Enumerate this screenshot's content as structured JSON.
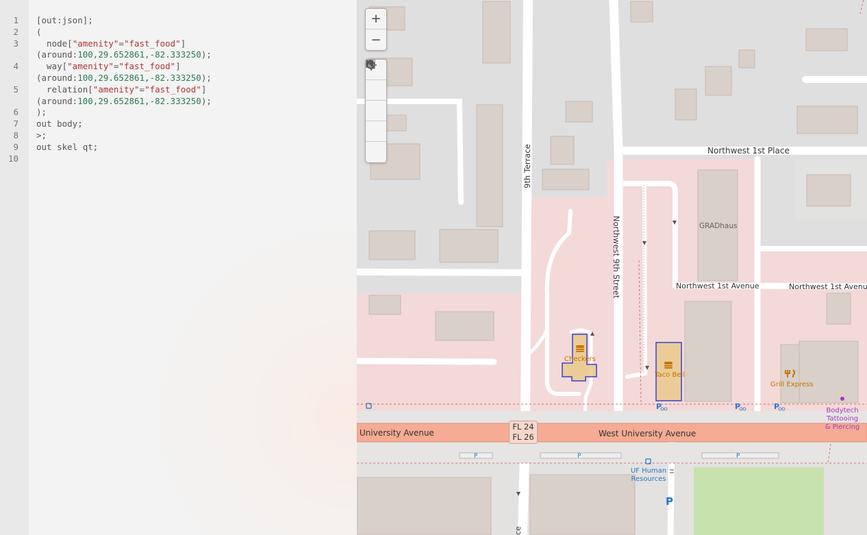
{
  "editor": {
    "line_numbers": [
      "1",
      "2",
      "3",
      "4",
      "5",
      "6",
      "7",
      "8",
      "9",
      "10"
    ],
    "lines": {
      "l1": "[out:json];",
      "l2": "(",
      "l3a_kw": "  node[",
      "l3a_s1": "\"amenity\"",
      "l3a_eq": "=",
      "l3a_s2": "\"fast_food\"",
      "l3a_end": "]",
      "l3b_pre": "(around:",
      "l3b_nums": "100,29.652861,-82.333250",
      "l3b_end": ");",
      "l4a_kw": "  way[",
      "l4a_s1": "\"amenity\"",
      "l4a_eq": "=",
      "l4a_s2": "\"fast_food\"",
      "l4a_end": "]",
      "l4b_pre": "(around:",
      "l4b_nums": "100,29.652861,-82.333250",
      "l4b_end": ");",
      "l5a_kw": "  relation[",
      "l5a_s1": "\"amenity\"",
      "l5a_eq": "=",
      "l5a_s2": "\"fast_food\"",
      "l5a_end": "]",
      "l5b_pre": "(around:",
      "l5b_nums": "100,29.652861,-82.333250",
      "l5b_end": ");",
      "l6": ");",
      "l7": "out body;",
      "l8": ">;",
      "l9": "out skel qt;",
      "l10": ""
    }
  },
  "map": {
    "controls": {
      "zoom_in": "+",
      "zoom_out": "−"
    },
    "streets": {
      "nw_1st_place": "Northwest 1st Place",
      "terrace_9th": "9th Terrace",
      "nw_9th_street": "Northwest 9th Street",
      "nw_1st_avenue_a": "Northwest 1st Avenue",
      "nw_1st_avenue_b": "Northwest 1st Avenue",
      "university_ave_left": "University Avenue",
      "west_university_ave": "West University Avenue",
      "terrace_cut": "ce"
    },
    "shield": {
      "line1": "FL 24",
      "line2": "FL 26"
    },
    "pois": {
      "gradhaus": "GRADhaus",
      "checkers": "Checkers",
      "taco_bell": "Taco Bell",
      "grill_express": "Grill Express",
      "bodytech_1": "Bodytech",
      "bodytech_2": "Tattooing",
      "bodytech_3": "& Piercing",
      "uf_hr_1": "UF Human",
      "uf_hr_2": "Resources"
    },
    "parking_letter": "P",
    "colors": {
      "residential_pink": "#f3d9d8",
      "building": "#d9d0c9",
      "road": "#ffffff",
      "primary_road": "#f7b8a4",
      "fast_food_fill": "#e9c98d",
      "highlight_stroke": "#3344cc",
      "park_green": "#c8e2ae",
      "poi_orange": "#c77400",
      "poi_purple": "#a33dbd",
      "transit_blue": "#2a76c9"
    }
  }
}
